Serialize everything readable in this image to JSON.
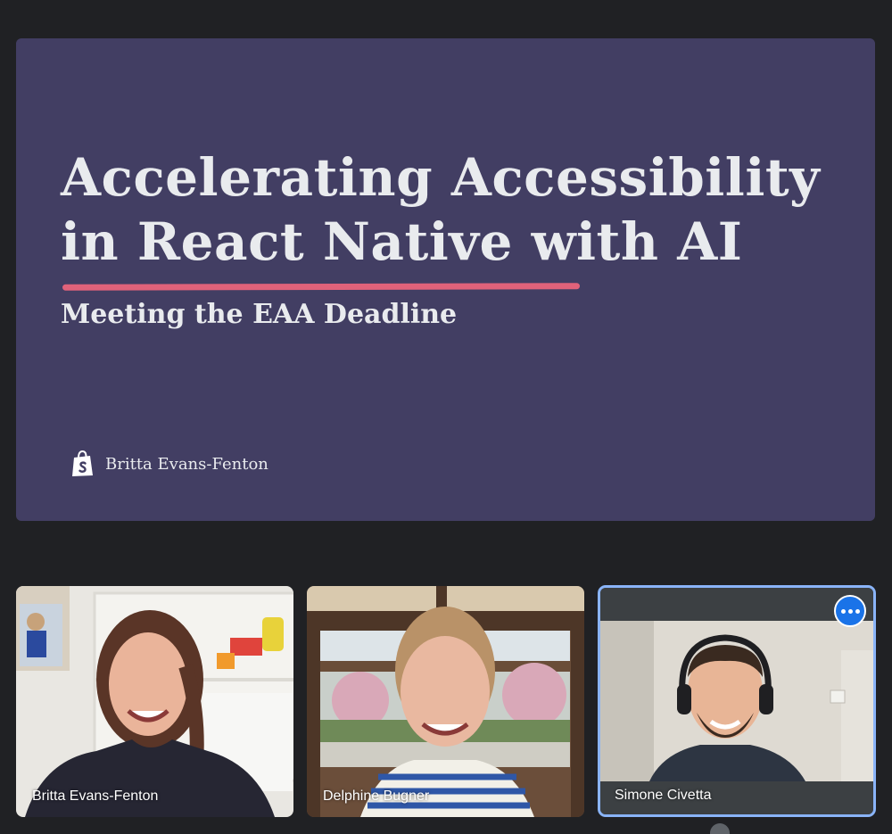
{
  "slide": {
    "title_line1": "Accelerating Accessibility",
    "title_line2": "in React Native with AI",
    "subtitle": "Meeting the EAA Deadline",
    "presenter": "Britta Evans-Fenton",
    "logo_icon": "shopify-bag-icon",
    "background": "#423e63",
    "underline_color": "#e0627a"
  },
  "participants": [
    {
      "name": "Britta Evans-Fenton",
      "active": false
    },
    {
      "name": "Delphine Bugner",
      "active": false
    },
    {
      "name": "Simone Civetta",
      "active": true,
      "menu_icon": "more-options-icon"
    }
  ]
}
